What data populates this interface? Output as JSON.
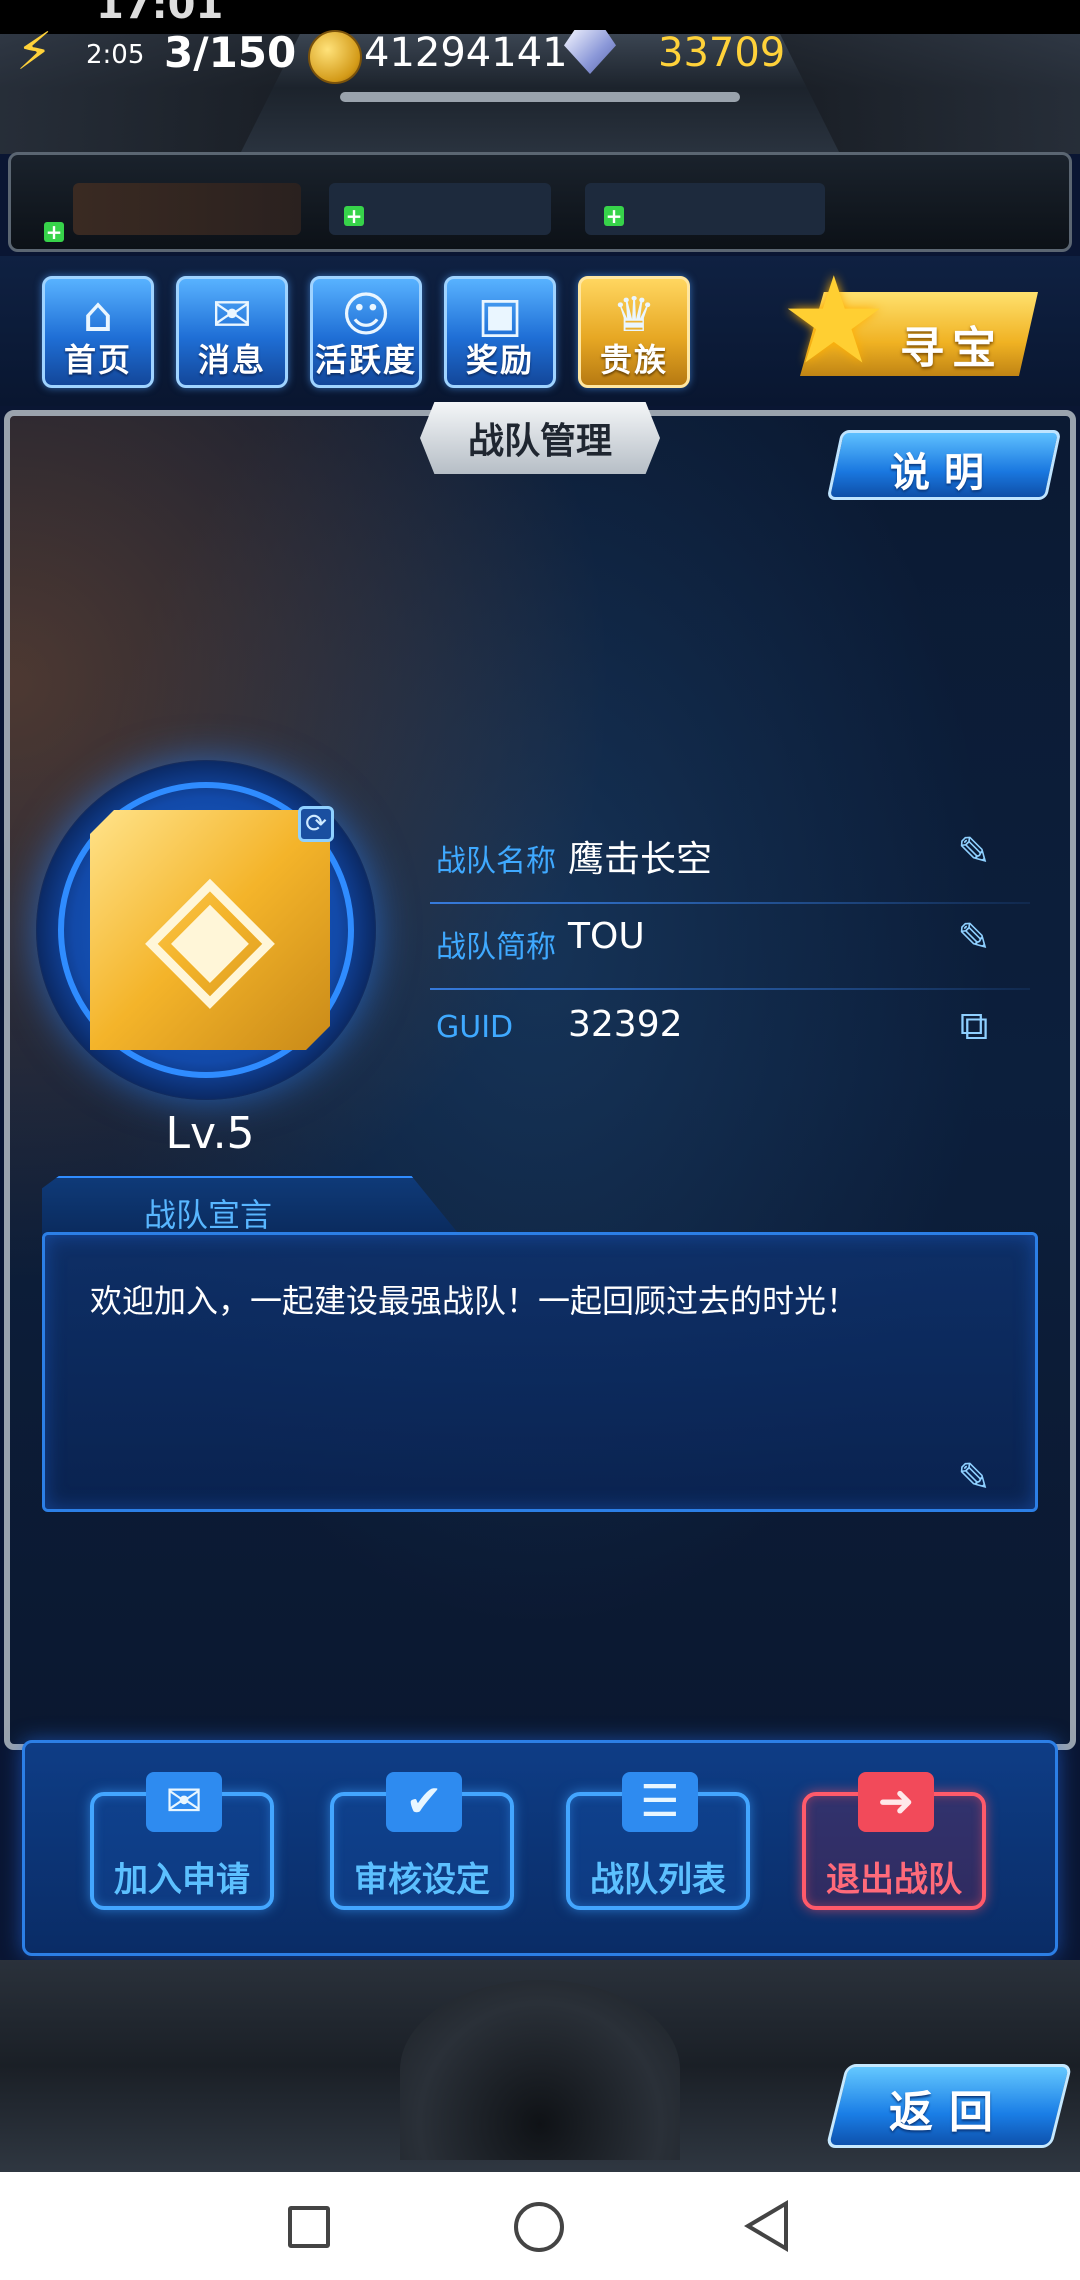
{
  "status_bar": {
    "time": "17:01"
  },
  "resources": {
    "energy_timer": "2:05",
    "energy": "3/150",
    "gold": "41294141",
    "gems": "33709"
  },
  "menu": {
    "items": [
      {
        "label": "首页",
        "icon": "home-icon"
      },
      {
        "label": "消息",
        "icon": "message-icon"
      },
      {
        "label": "活跃度",
        "icon": "activity-icon"
      },
      {
        "label": "奖励",
        "icon": "reward-icon"
      },
      {
        "label": "贵族",
        "icon": "noble-icon"
      }
    ],
    "treasure_label": "寻宝"
  },
  "panel": {
    "title": "战队管理",
    "help_label": "说明"
  },
  "team": {
    "level": "Lv.5",
    "fields": [
      {
        "label": "战队名称",
        "value": "鹰击长空",
        "action_icon": "edit-icon"
      },
      {
        "label": "战队简称",
        "value": "TOU",
        "action_icon": "edit-icon"
      },
      {
        "label": "GUID",
        "value": "32392",
        "action_icon": "copy-icon"
      }
    ]
  },
  "manifesto": {
    "title": "战队宣言",
    "text": "欢迎加入，一起建设最强战队！一起回顾过去的时光！"
  },
  "actions": [
    {
      "label": "加入申请",
      "icon": "mail-icon"
    },
    {
      "label": "审核设定",
      "icon": "check-icon"
    },
    {
      "label": "战队列表",
      "icon": "list-icon"
    },
    {
      "label": "退出战队",
      "icon": "exit-icon"
    }
  ],
  "back_label": "返回",
  "colors": {
    "accent_blue": "#2e8bf0",
    "gold": "#ffd23a",
    "danger": "#ff5a6a"
  }
}
